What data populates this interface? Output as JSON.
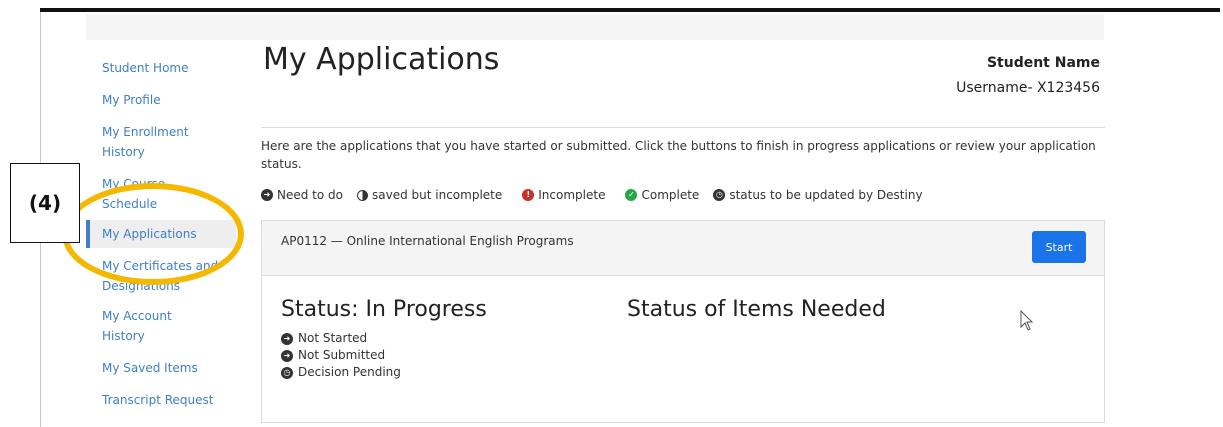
{
  "sidebar": {
    "items": [
      {
        "label": "Student Home"
      },
      {
        "label": "My Profile"
      },
      {
        "label": "My Enrollment History"
      },
      {
        "label": "My Course Schedule"
      },
      {
        "label": "My Applications",
        "active": true
      },
      {
        "label": "My Certificates and Designations"
      },
      {
        "label": "My Account History"
      },
      {
        "label": "My Saved Items"
      },
      {
        "label": "Transcript Request"
      }
    ]
  },
  "header": {
    "title": "My Applications",
    "student_name": "Student Name",
    "username": "Username- X123456"
  },
  "intro": "Here are the applications that you have started or submitted. Click the buttons to finish in progress applications or review your application status.",
  "legend": {
    "need_to_do": "Need to do",
    "saved": "saved but incomplete",
    "incomplete": "Incomplete",
    "complete": "Complete",
    "status_update": "status to be updated by Destiny"
  },
  "application": {
    "code_title": "AP0112 — Online International English Programs",
    "start_label": "Start",
    "status_title": "Status: In Progress",
    "items_needed_title": "Status of Items Needed",
    "status_items": [
      "Not Started",
      "Not Submitted",
      "Decision Pending"
    ]
  },
  "annotation": {
    "label": "(4)"
  },
  "colors": {
    "link": "#3f7fc4",
    "primary": "#1a73e8",
    "highlight": "#f5b800",
    "incomplete": "#c9302c",
    "complete": "#28a745"
  }
}
